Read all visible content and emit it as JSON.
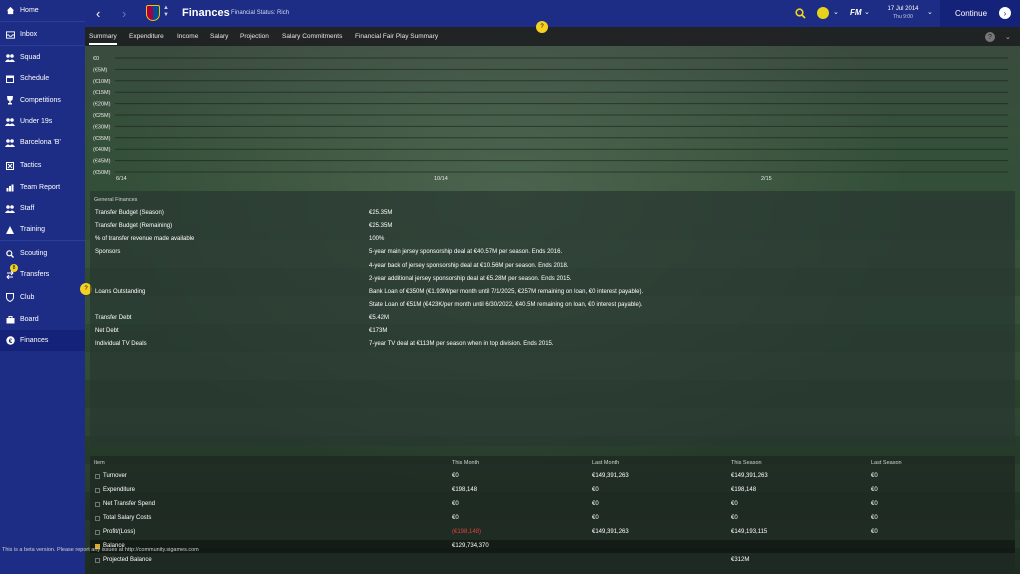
{
  "sidebar": {
    "items": [
      {
        "label": "Home",
        "icon": "home-icon"
      },
      {
        "label": "Inbox",
        "icon": "inbox-icon"
      },
      {
        "label": "Squad",
        "icon": "squad-icon"
      },
      {
        "label": "Schedule",
        "icon": "calendar-icon"
      },
      {
        "label": "Competitions",
        "icon": "trophy-icon"
      },
      {
        "label": "Under 19s",
        "icon": "people-icon"
      },
      {
        "label": "Barcelona 'B'",
        "icon": "people-icon"
      },
      {
        "label": "Tactics",
        "icon": "tactics-icon"
      },
      {
        "label": "Team Report",
        "icon": "report-icon"
      },
      {
        "label": "Staff",
        "icon": "staff-icon"
      },
      {
        "label": "Training",
        "icon": "training-icon"
      },
      {
        "label": "Scouting",
        "icon": "scouting-icon"
      },
      {
        "label": "Transfers",
        "icon": "transfers-icon",
        "badge": "8"
      },
      {
        "label": "Club",
        "icon": "shield-icon"
      },
      {
        "label": "Board",
        "icon": "board-icon"
      },
      {
        "label": "Finances",
        "icon": "euro-icon",
        "active": true
      }
    ]
  },
  "header": {
    "back": "‹",
    "forward": "›",
    "title": "Finances",
    "subtitle": "Financial Status: Rich",
    "date": "17 Jul 2014",
    "time": "Thu 9:00",
    "continue_label": "Continue"
  },
  "tabs": [
    {
      "label": "Summary",
      "active": true
    },
    {
      "label": "Expenditure"
    },
    {
      "label": "Income"
    },
    {
      "label": "Salary"
    },
    {
      "label": "Projection"
    },
    {
      "label": "Salary Commitments"
    },
    {
      "label": "Financial Fair Play Summary"
    }
  ],
  "hint": "?",
  "chart_data": {
    "type": "line",
    "y_tick_labels": [
      "€0",
      "(€5M)",
      "(€10M)",
      "(€15M)",
      "(€20M)",
      "(€25M)",
      "(€30M)",
      "(€35M)",
      "(€40M)",
      "(€45M)",
      "(€50M)"
    ],
    "x_tick_labels": [
      "6/14",
      "10/14",
      "2/15"
    ],
    "ylim": [
      -50,
      0
    ],
    "y_unit": "€M",
    "grid": true,
    "series": []
  },
  "general": {
    "title": "General Finances",
    "rows": [
      {
        "label": "Transfer Budget (Season)",
        "value": "€25.35M"
      },
      {
        "label": "Transfer Budget (Remaining)",
        "value": "€25.35M"
      },
      {
        "label": "% of transfer revenue made available",
        "value": "100%"
      },
      {
        "label": "Sponsors",
        "value": "5-year main jersey sponsorship deal at €40.57M per season. Ends 2016."
      },
      {
        "label": "",
        "value": "4-year back of jersey sponsorship deal at €10.56M per season. Ends 2018."
      },
      {
        "label": "",
        "value": "2-year additional jersey sponsorship deal at €5.28M per season. Ends 2015."
      },
      {
        "label": "Loans Outstanding",
        "value": "Bank Loan of €350M (€1.93M/per month until 7/1/2025, €257M remaining on loan, €0 interest payable)."
      },
      {
        "label": "",
        "value": "State Loan of €51M (€423K/per month until 6/30/2022, €40.5M remaining on loan, €0 interest payable)."
      },
      {
        "label": "Transfer Debt",
        "value": "€5.42M"
      },
      {
        "label": "Net Debt",
        "value": "€173M"
      },
      {
        "label": "Individual TV Deals",
        "value": "7-year TV deal at €113M per season when in top division. Ends 2015."
      }
    ]
  },
  "table": {
    "headers": [
      "Item",
      "This Month",
      "Last Month",
      "This Season",
      "Last Season"
    ],
    "rows": [
      {
        "item": "Turnover",
        "this_month": "€0",
        "last_month": "€149,391,263",
        "this_season": "€149,391,263",
        "last_season": "€0"
      },
      {
        "item": "Expenditure",
        "this_month": "€198,148",
        "last_month": "€0",
        "this_season": "€198,148",
        "last_season": "€0"
      },
      {
        "item": "Net Transfer Spend",
        "this_month": "€0",
        "last_month": "€0",
        "this_season": "€0",
        "last_season": "€0"
      },
      {
        "item": "Total Salary Costs",
        "this_month": "€0",
        "last_month": "€0",
        "this_season": "€0",
        "last_season": "€0"
      },
      {
        "item": "Profit/(Loss)",
        "this_month": "(€198,148)",
        "last_month": "€149,391,263",
        "this_season": "€149,193,115",
        "last_season": "€0",
        "negative_this_month": true
      },
      {
        "item": "Balance",
        "this_month": "€129,734,370",
        "last_month": "",
        "this_season": "",
        "last_season": ""
      },
      {
        "item": "Projected Balance",
        "this_month": "",
        "last_month": "",
        "this_season": "€312M",
        "last_season": ""
      }
    ]
  },
  "beta_notice": "This is a beta version. Please report any issues at http://community.sigames.com",
  "colors": {
    "sidebar": "#1d2d85",
    "sidebar_active": "#15227a",
    "hint_yellow": "#f4d21f",
    "negative": "#e0403a"
  }
}
